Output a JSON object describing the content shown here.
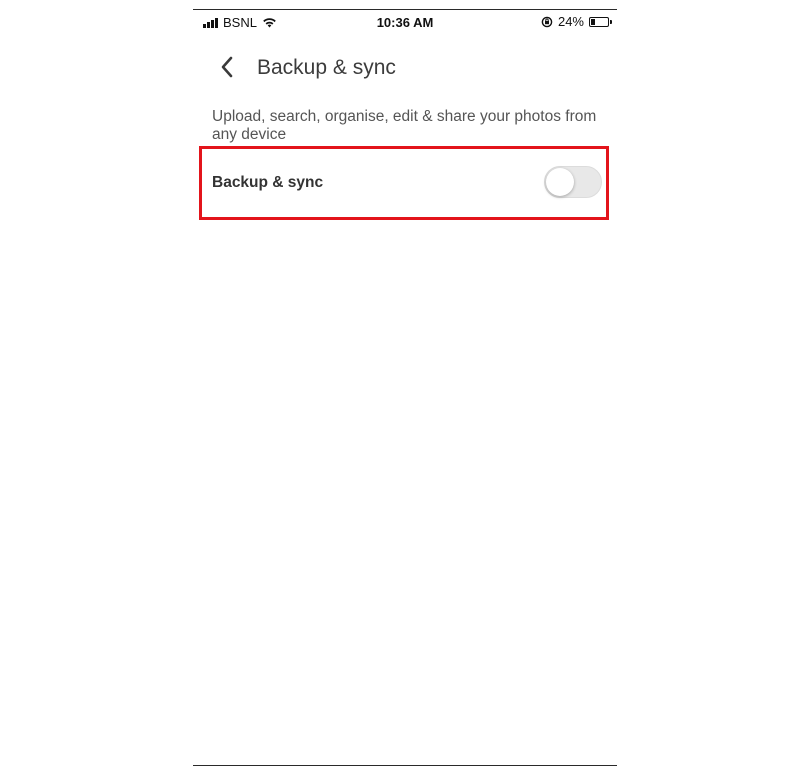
{
  "status_bar": {
    "carrier": "BSNL",
    "time": "10:36 AM",
    "battery_percent": "24%",
    "battery_level": 0.24,
    "icons": [
      "signal-icon",
      "wifi-icon",
      "orientation-lock-icon",
      "battery-icon"
    ]
  },
  "header": {
    "back_icon": "chevron-left-icon",
    "title": "Backup & sync"
  },
  "description": "Upload, search, organise, edit & share your photos from any device",
  "setting": {
    "label": "Backup & sync",
    "toggle_on": false
  },
  "colors": {
    "highlight": "#e3141b",
    "toggle_off_track": "#e8e8e8",
    "text_primary": "#333333"
  }
}
